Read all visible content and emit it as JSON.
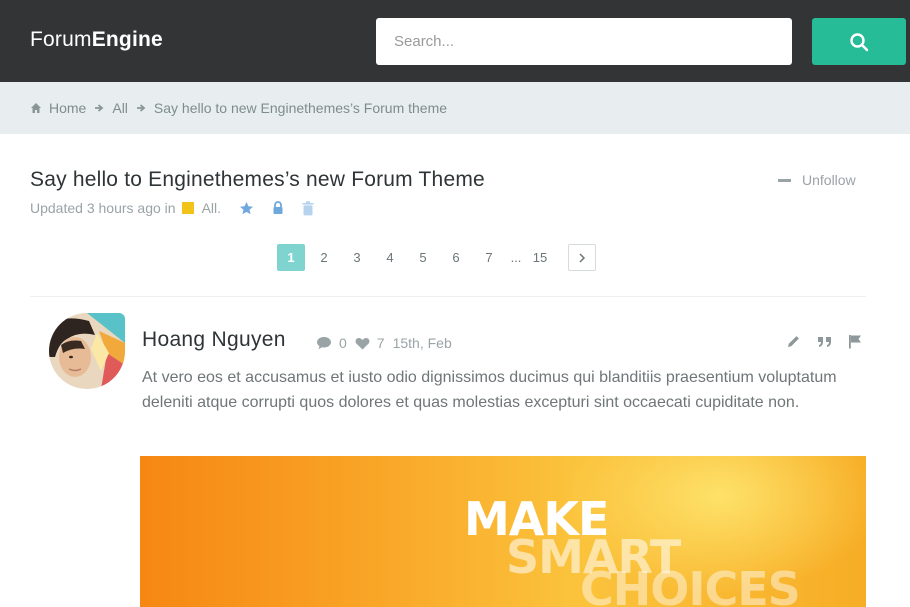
{
  "app": {
    "logo_light": "Forum",
    "logo_bold": "Engine"
  },
  "search": {
    "placeholder": "Search...",
    "value": "",
    "button_icon": "search-icon"
  },
  "breadcrumb": {
    "home_icon": "home-icon",
    "items": [
      "Home",
      "All",
      "Say hello to new Enginethemes’s Forum theme"
    ],
    "separator_icon": "arrow-right-icon"
  },
  "topic": {
    "title": "Say hello to Enginethemes’s new Forum Theme",
    "unfollow_label": "Unfollow",
    "updated_text": "Updated 3 hours ago in",
    "category": "All.",
    "category_color": "#f0c419",
    "meta_icons": [
      "star-icon",
      "lock-icon",
      "trash-icon"
    ]
  },
  "pagination": {
    "pages": [
      "1",
      "2",
      "3",
      "4",
      "5",
      "6",
      "7"
    ],
    "ellipsis": "...",
    "last_page": "15",
    "current": "1",
    "next_icon": "chevron-right-icon"
  },
  "post": {
    "author": "Hoang Nguyen",
    "comments": "0",
    "likes": "7",
    "date": "15th, Feb",
    "body": "At vero eos et accusamus et iusto odio dignissimos ducimus qui blanditiis praesentium voluptatum deleniti atque corrupti quos dolores et quas molestias excepturi sint occaecati cupiditate non.",
    "actions": [
      "edit-icon",
      "quote-icon",
      "flag-icon"
    ],
    "image_text": [
      "MAKE",
      "SMART",
      "CHOICES"
    ]
  },
  "colors": {
    "topbar": "#333435",
    "accent": "#26bc98",
    "crumb_bg": "#e8eeef",
    "active_page": "#7fd4d0",
    "icon_blue": "#6fa8dc"
  }
}
